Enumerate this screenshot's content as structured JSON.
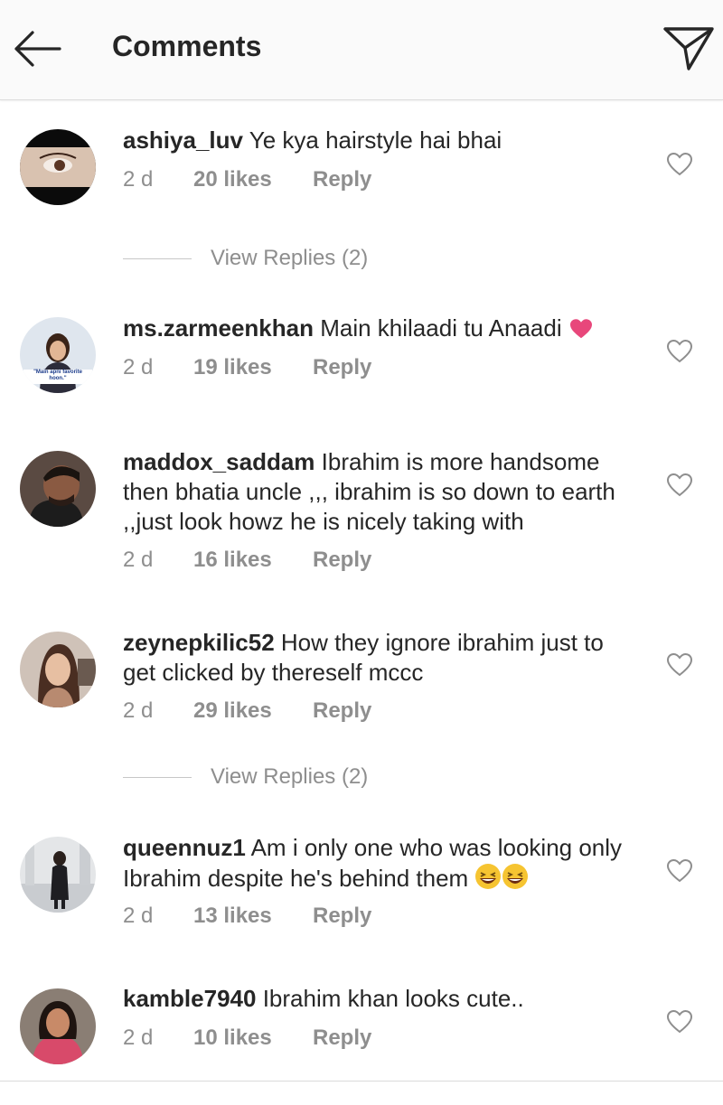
{
  "header": {
    "title": "Comments",
    "back_icon": "arrow-left-icon",
    "send_icon": "paper-plane-icon"
  },
  "comments": [
    {
      "username": "ashiya_luv",
      "text": "Ye kya hairstyle hai bhai",
      "time": "2 d",
      "likes": "20 likes",
      "reply": "Reply",
      "view_replies": "View Replies (2)"
    },
    {
      "username": "ms.zarmeenkhan",
      "text": "Main khilaadi tu Anaadi",
      "emoji": "heart-emoji",
      "time": "2 d",
      "likes": "19 likes",
      "reply": "Reply",
      "avatar_caption": "\"Main apni favorite hoon.\""
    },
    {
      "username": "maddox_saddam",
      "text": "Ibrahim is more handsome then bhatia uncle ,,, ibrahim is so down to earth ,,just look howz he is nicely taking with",
      "time": "2 d",
      "likes": "16 likes",
      "reply": "Reply"
    },
    {
      "username": "zeynepkilic52",
      "text": "How they ignore ibrahim just to get clicked by thereself mccc",
      "time": "2 d",
      "likes": "29 likes",
      "reply": "Reply",
      "view_replies": "View Replies (2)"
    },
    {
      "username": "queennuz1",
      "text": "Am i only one who was looking only Ibrahim despite he's behind them",
      "emoji": "grinning-squinting-emoji x2",
      "time": "2 d",
      "likes": "13 likes",
      "reply": "Reply"
    },
    {
      "username": "kamble7940",
      "text": "Ibrahim khan looks cute..",
      "time": "2 d",
      "likes": "10 likes",
      "reply": "Reply"
    }
  ],
  "colors": {
    "text": "#262626",
    "secondary": "#8e8e8e",
    "header_bg": "#fafafa",
    "heart_emoji": "#e8477b"
  }
}
